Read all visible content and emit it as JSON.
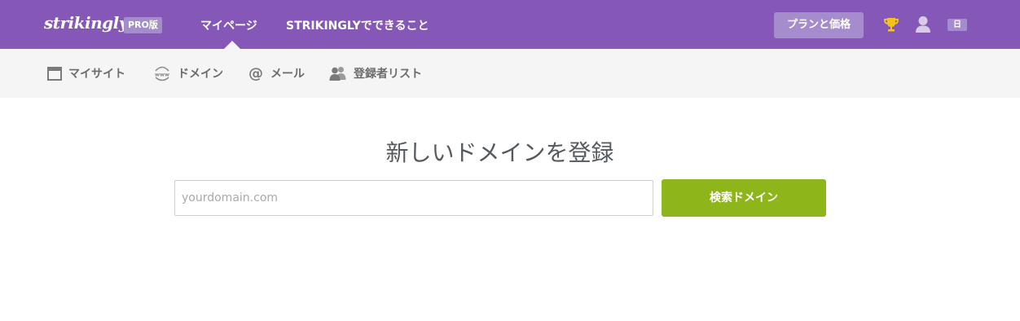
{
  "header": {
    "logo_text": "strikingly",
    "pro_badge": "PRO版",
    "nav": {
      "mypage": "マイページ",
      "features": "STRIKINGLYでできること"
    },
    "plan_button": "プランと価格",
    "trophy_icon": "trophy-icon",
    "user_icon": "user-icon",
    "language": "日"
  },
  "subnav": {
    "items": [
      {
        "label": "マイサイト",
        "icon": "browser-window-icon"
      },
      {
        "label": "ドメイン",
        "icon": "www-globe-icon"
      },
      {
        "label": "メール",
        "icon": "at-sign-icon"
      },
      {
        "label": "登録者リスト",
        "icon": "users-icon"
      }
    ]
  },
  "main": {
    "heading": "新しいドメインを登録",
    "domain_input": {
      "placeholder": "yourdomain.com",
      "value": ""
    },
    "search_button": "検索ドメイン"
  },
  "colors": {
    "header_bg": "#8558b8",
    "badge_bg": "#a58ccc",
    "subnav_bg": "#f5f5f5",
    "button_green": "#8eb51a",
    "trophy": "#f3c21b"
  }
}
